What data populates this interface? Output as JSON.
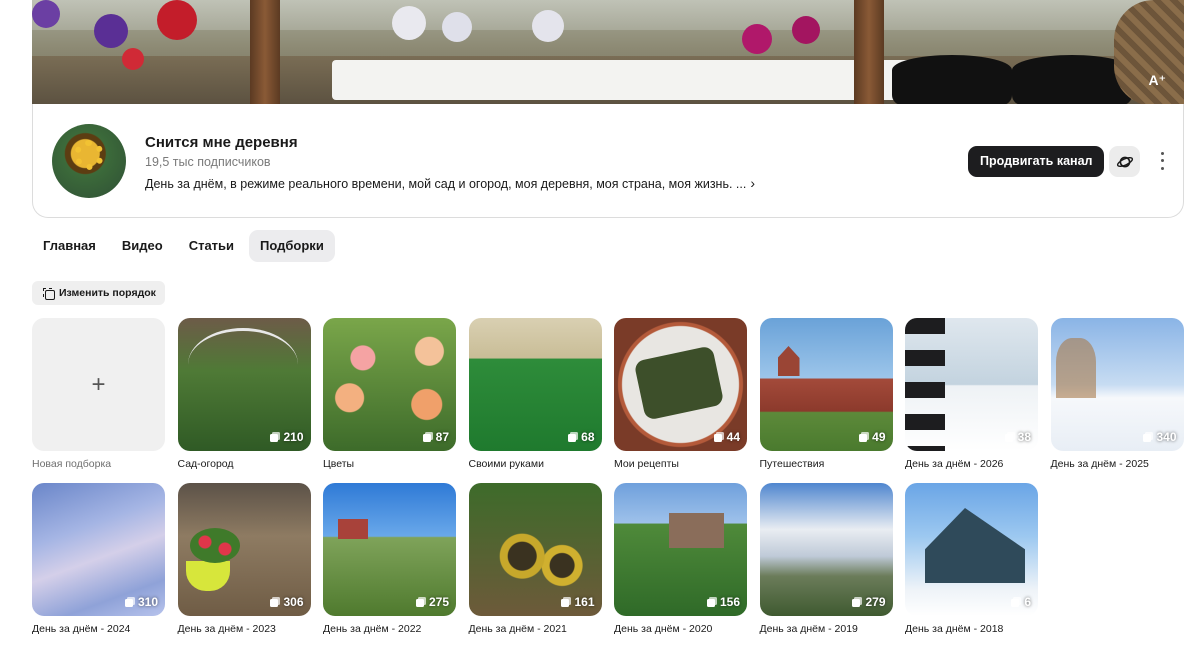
{
  "banner": {
    "badge": "A⁺"
  },
  "channel": {
    "title": "Снится мне деревня",
    "subscribers": "19,5 тыс подписчиков",
    "description": "День за днём, в режиме реального времени, мой сад и огород, моя деревня, моя страна, моя жизнь. ...",
    "promote_label": "Продвигать канал",
    "planet_icon": "planet-icon",
    "more_icon": "more-vertical-icon"
  },
  "tabs": [
    {
      "label": "Главная",
      "active": false
    },
    {
      "label": "Видео",
      "active": false
    },
    {
      "label": "Статьи",
      "active": false
    },
    {
      "label": "Подборки",
      "active": true
    }
  ],
  "reorder_label": "Изменить порядок",
  "new_collection_label": "Новая подборка",
  "collections": [
    {
      "label": "Сад-огород",
      "count": "210"
    },
    {
      "label": "Цветы",
      "count": "87"
    },
    {
      "label": "Своими руками",
      "count": "68"
    },
    {
      "label": "Мои рецепты",
      "count": "44"
    },
    {
      "label": "Путешествия",
      "count": "49"
    },
    {
      "label": "День за днём - 2026",
      "count": "38"
    },
    {
      "label": "День за днём - 2025",
      "count": "340"
    },
    {
      "label": "День за днём - 2024",
      "count": "310"
    },
    {
      "label": "День за днём - 2023",
      "count": "306"
    },
    {
      "label": "День за днём - 2022",
      "count": "275"
    },
    {
      "label": "День за днём - 2021",
      "count": "161"
    },
    {
      "label": "День за днём - 2020",
      "count": "156"
    },
    {
      "label": "День за днём - 2019",
      "count": "279"
    },
    {
      "label": "День за днём - 2018",
      "count": "6"
    }
  ]
}
